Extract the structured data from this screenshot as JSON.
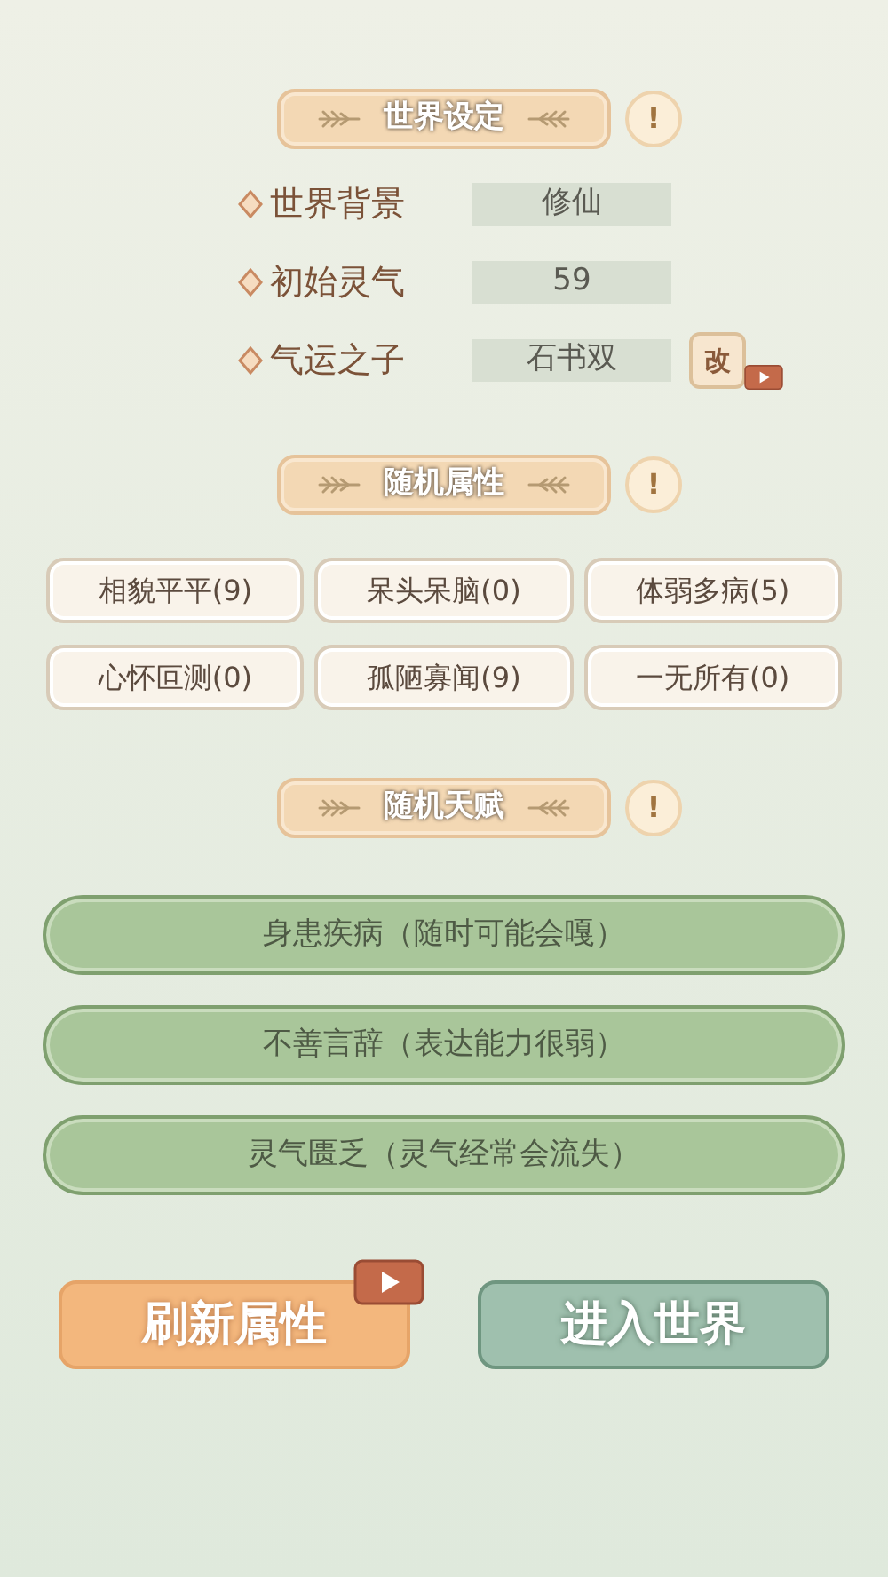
{
  "world_settings": {
    "title": "世界设定",
    "info": "!",
    "rows": [
      {
        "label": "世界背景",
        "value": "修仙"
      },
      {
        "label": "初始灵气",
        "value": "59"
      },
      {
        "label": "气运之子",
        "value": "石书双",
        "action": "改"
      }
    ]
  },
  "random_attributes": {
    "title": "随机属性",
    "info": "!",
    "items": [
      {
        "label": "相貌平平(9)"
      },
      {
        "label": "呆头呆脑(0)"
      },
      {
        "label": "体弱多病(5)"
      },
      {
        "label": "心怀叵测(0)"
      },
      {
        "label": "孤陋寡闻(9)"
      },
      {
        "label": "一无所有(0)"
      }
    ]
  },
  "random_talents": {
    "title": "随机天赋",
    "info": "!",
    "items": [
      {
        "label": "身患疾病（随时可能会嘎）"
      },
      {
        "label": "不善言辞（表达能力很弱）"
      },
      {
        "label": "灵气匮乏（灵气经常会流失）"
      }
    ]
  },
  "buttons": [
    {
      "label": "刷新属性",
      "kind": "ad"
    },
    {
      "label": "进入世界",
      "kind": "plain"
    }
  ]
}
